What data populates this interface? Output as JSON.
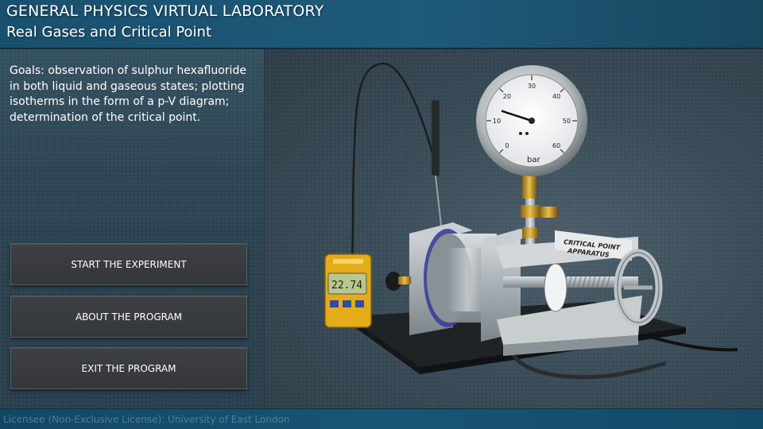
{
  "header": {
    "title": "GENERAL PHYSICS VIRTUAL LABORATORY",
    "subtitle": "Real Gases and Critical Point"
  },
  "goals_text": "Goals: observation of sulphur hexafluoride in both liquid and gaseous states; plotting isotherms in the form of a p-V diagram; determination of the critical point.",
  "menu": {
    "start_label": "START THE EXPERIMENT",
    "about_label": "ABOUT THE PROGRAM",
    "exit_label": "EXIT THE PROGRAM"
  },
  "footer": {
    "license": "Licensee (Non-Exclusive License): University of East London"
  },
  "apparatus": {
    "gauge": {
      "unit": "bar",
      "ticks": [
        "0",
        "10",
        "20",
        "30",
        "40",
        "50",
        "60"
      ],
      "needle_value": 14
    },
    "thermometer_reading": "22.74",
    "label_line1": "CRITICAL POINT",
    "label_line2": "APPARATUS"
  },
  "colors": {
    "header": "#1e5a79",
    "panel": "#2d4452",
    "button": "#3a3d40",
    "license_text": "#4f7d97",
    "meter_yellow": "#e8b21c",
    "lcd": "#b9c78f"
  }
}
